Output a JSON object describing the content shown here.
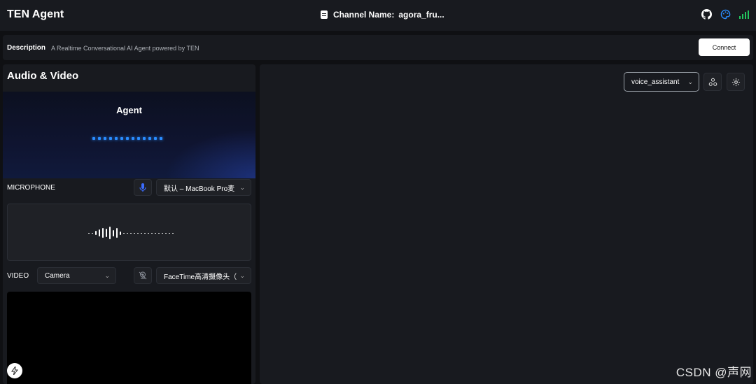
{
  "header": {
    "app_title": "TEN Agent",
    "channel_label": "Channel Name:",
    "channel_value": "agora_fru..."
  },
  "description": {
    "title": "Description",
    "text": "A Realtime Conversational AI Agent powered by TEN",
    "connect_label": "Connect"
  },
  "left_panel": {
    "title": "Audio & Video",
    "agent_name": "Agent",
    "microphone": {
      "label": "MICROPHONE",
      "device": "默认 – MacBook Pro麦"
    },
    "video": {
      "label": "VIDEO",
      "source": "Camera",
      "device": "FaceTime高清摄像头（"
    }
  },
  "right_panel": {
    "graph_select": "voice_assistant"
  },
  "watermark": "CSDN @声网",
  "colors": {
    "accent_blue": "#2a8cff",
    "signal_green": "#22c55e",
    "background": "#0f1013",
    "panel": "#181a1f"
  },
  "icons": [
    "document-icon",
    "github-icon",
    "palette-icon",
    "signal-icon",
    "mic-icon",
    "camera-off-icon",
    "network-icon",
    "gear-icon",
    "bolt-icon",
    "chevron-down-icon"
  ]
}
